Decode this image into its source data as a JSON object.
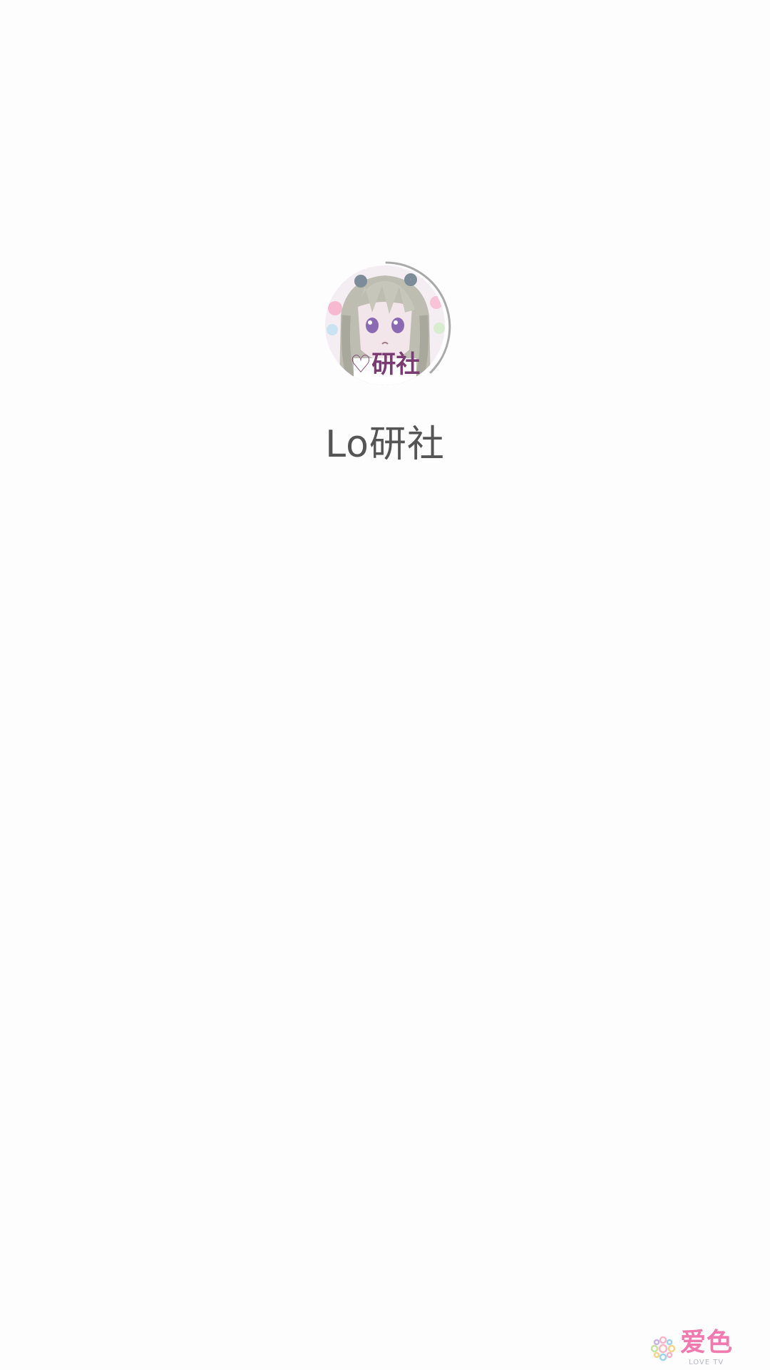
{
  "splash": {
    "app_name": "Lo研社",
    "avatar_caption": "♡研社",
    "avatar_icon": "anime-girl-avatar"
  },
  "brand": {
    "label": "爱色",
    "sub_label": "LOVE TV",
    "icon": "flower-icon"
  },
  "colors": {
    "background": "#fdfdfd",
    "app_name_text": "#555555",
    "spinner_arc": "#a9a9a9",
    "brand_pink": "#f07ab0",
    "brand_blue": "#7fc4e9"
  }
}
